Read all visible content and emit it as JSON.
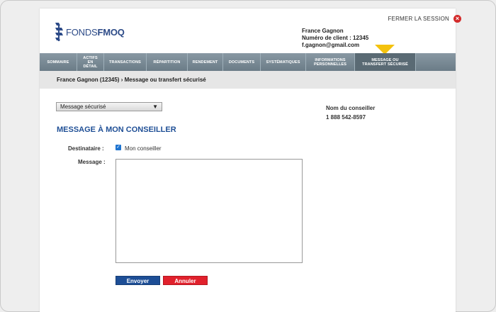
{
  "header": {
    "logout_label": "FERMER LA SESSION",
    "logo_light": "FONDS",
    "logo_bold": "FMOQ"
  },
  "user": {
    "name": "France Gagnon",
    "client_number": "Numéro de client : 12345",
    "email": "f.gagnon@gmail.com"
  },
  "nav": {
    "items": [
      {
        "label": "SOMMAIRE"
      },
      {
        "label": "ACTIFS EN DÉTAIL"
      },
      {
        "label": "TRANSACTIONS"
      },
      {
        "label": "RÉPARTITION"
      },
      {
        "label": "RENDEMENT"
      },
      {
        "label": "DOCUMENTS"
      },
      {
        "label": "SYSTÉMATIQUES"
      },
      {
        "label": "INFORMATIONS PERSONNELLES"
      },
      {
        "label": "MESSAGE OU TRANSFERT SÉCURISÉ"
      }
    ],
    "active_index": 8
  },
  "breadcrumb": "France Gagnon (12345) › Message ou transfert sécurisé",
  "form": {
    "type_select": "Message sécurisé",
    "heading": "MESSAGE À MON CONSEILLER",
    "recipient_label": "Destinataire :",
    "recipient_option": "Mon conseiller",
    "message_label": "Message :",
    "message_value": "",
    "send_label": "Envoyer",
    "cancel_label": "Annuler"
  },
  "advisor": {
    "name_label": "Nom du conseiller",
    "phone": "1 888 542-8597"
  },
  "colors": {
    "brand": "#1f4f96",
    "nav": "#6b7c87",
    "accent_arrow": "#f4c20d",
    "cancel": "#e1212c"
  },
  "icons": [
    "close-icon",
    "fmoq-logo-icon",
    "chevron-down-icon",
    "checkbox-checked-icon"
  ]
}
